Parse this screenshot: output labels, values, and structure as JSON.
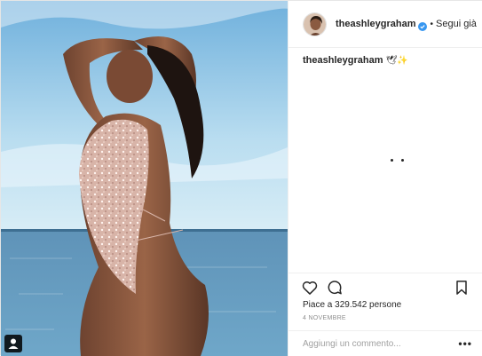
{
  "photo": {
    "alt_icon": "user-tag-icon",
    "sky_color": "#8fc5e6",
    "sea_color": "#4d7ea0"
  },
  "header": {
    "username": "theashleygraham",
    "separator": "•",
    "follow_label": "Segui già",
    "verified_icon": "verified-badge-icon",
    "verified_color": "#3897f0"
  },
  "caption": {
    "username": "theashleygraham",
    "emoji": "🕊✨"
  },
  "actions": {
    "like_icon": "heart-icon",
    "comment_icon": "comment-icon",
    "save_icon": "bookmark-icon"
  },
  "likes_text": "Piace a 329.542 persone",
  "date": "4 NOVEMBRE",
  "comment": {
    "placeholder": "Aggiungi un commento...",
    "more_label": "•••"
  }
}
